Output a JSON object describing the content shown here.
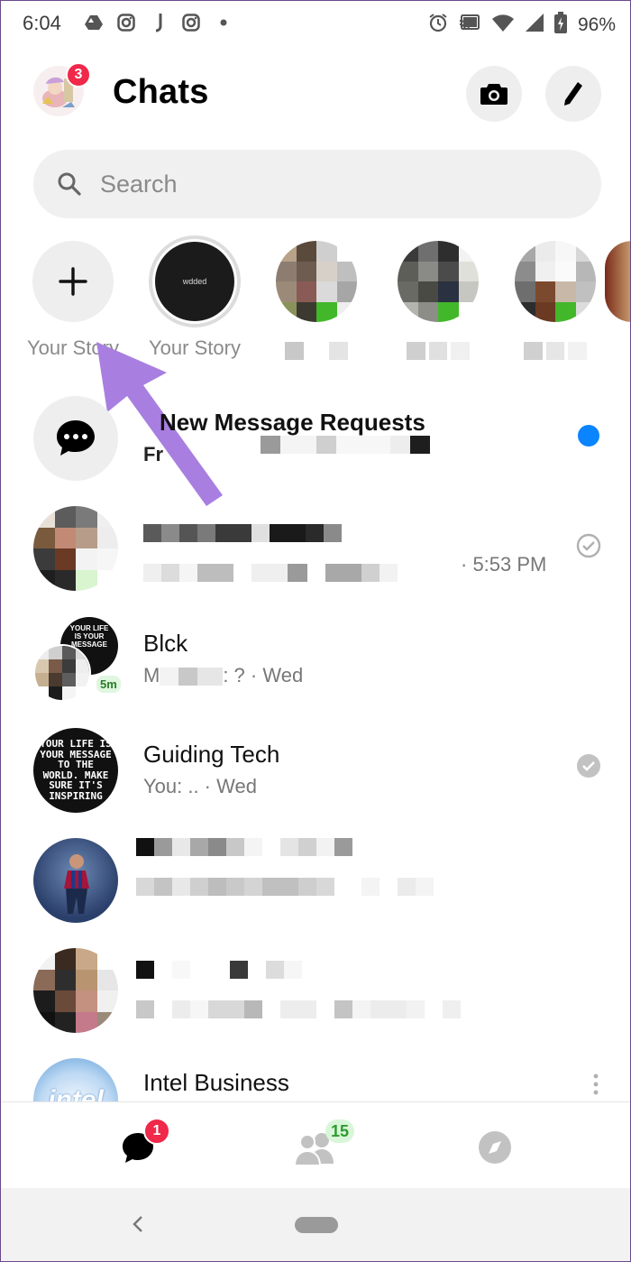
{
  "status_bar": {
    "time": "6:04",
    "battery": "96%",
    "left_icons": [
      "drive-icon",
      "instagram-icon",
      "j-icon",
      "instagram-icon",
      "dot-icon"
    ],
    "right_icons": [
      "alarm-icon",
      "cast-icon",
      "wifi-icon",
      "signal-icon",
      "battery-icon"
    ]
  },
  "header": {
    "title": "Chats",
    "profile_badge": "3",
    "camera_icon": "camera-icon",
    "compose_icon": "pencil-icon"
  },
  "search": {
    "placeholder": "Search"
  },
  "stories": [
    {
      "type": "add",
      "label": "Your Story"
    },
    {
      "type": "own",
      "label": "Your Story",
      "thumb_text": "wdded"
    },
    {
      "type": "friend",
      "label": ""
    },
    {
      "type": "friend",
      "label": ""
    },
    {
      "type": "friend",
      "label": ""
    }
  ],
  "chats": [
    {
      "name": "New Message Requests",
      "subtitle": "Fr",
      "unread": true,
      "bold": true
    },
    {
      "name": "",
      "subtitle": "",
      "time": "· 5:53 PM",
      "status": "sent"
    },
    {
      "name": "Blck",
      "subtitle": "M",
      "subtitle_tail": ": ? · Wed",
      "badge": "5m"
    },
    {
      "name": "Guiding Tech",
      "subtitle": "You: .. · Wed",
      "status": "delivered",
      "avatar_text": "YOUR LIFE IS YOUR MESSAGE TO THE WORLD. MAKE SURE IT'S INSPIRING"
    },
    {
      "name": "",
      "subtitle": ""
    },
    {
      "name": "",
      "subtitle": ""
    },
    {
      "name": "Intel Business",
      "subtitle": "",
      "avatar_text": "intel"
    }
  ],
  "bottom_nav": {
    "chats_badge": "1",
    "people_badge": "15",
    "items": [
      "chats-icon",
      "people-icon",
      "discover-icon"
    ]
  },
  "colors": {
    "accent_blue": "#0a84ff",
    "badge_red": "#f02849",
    "arrow_purple": "#a87fe0",
    "online_green": "#42b72a"
  }
}
